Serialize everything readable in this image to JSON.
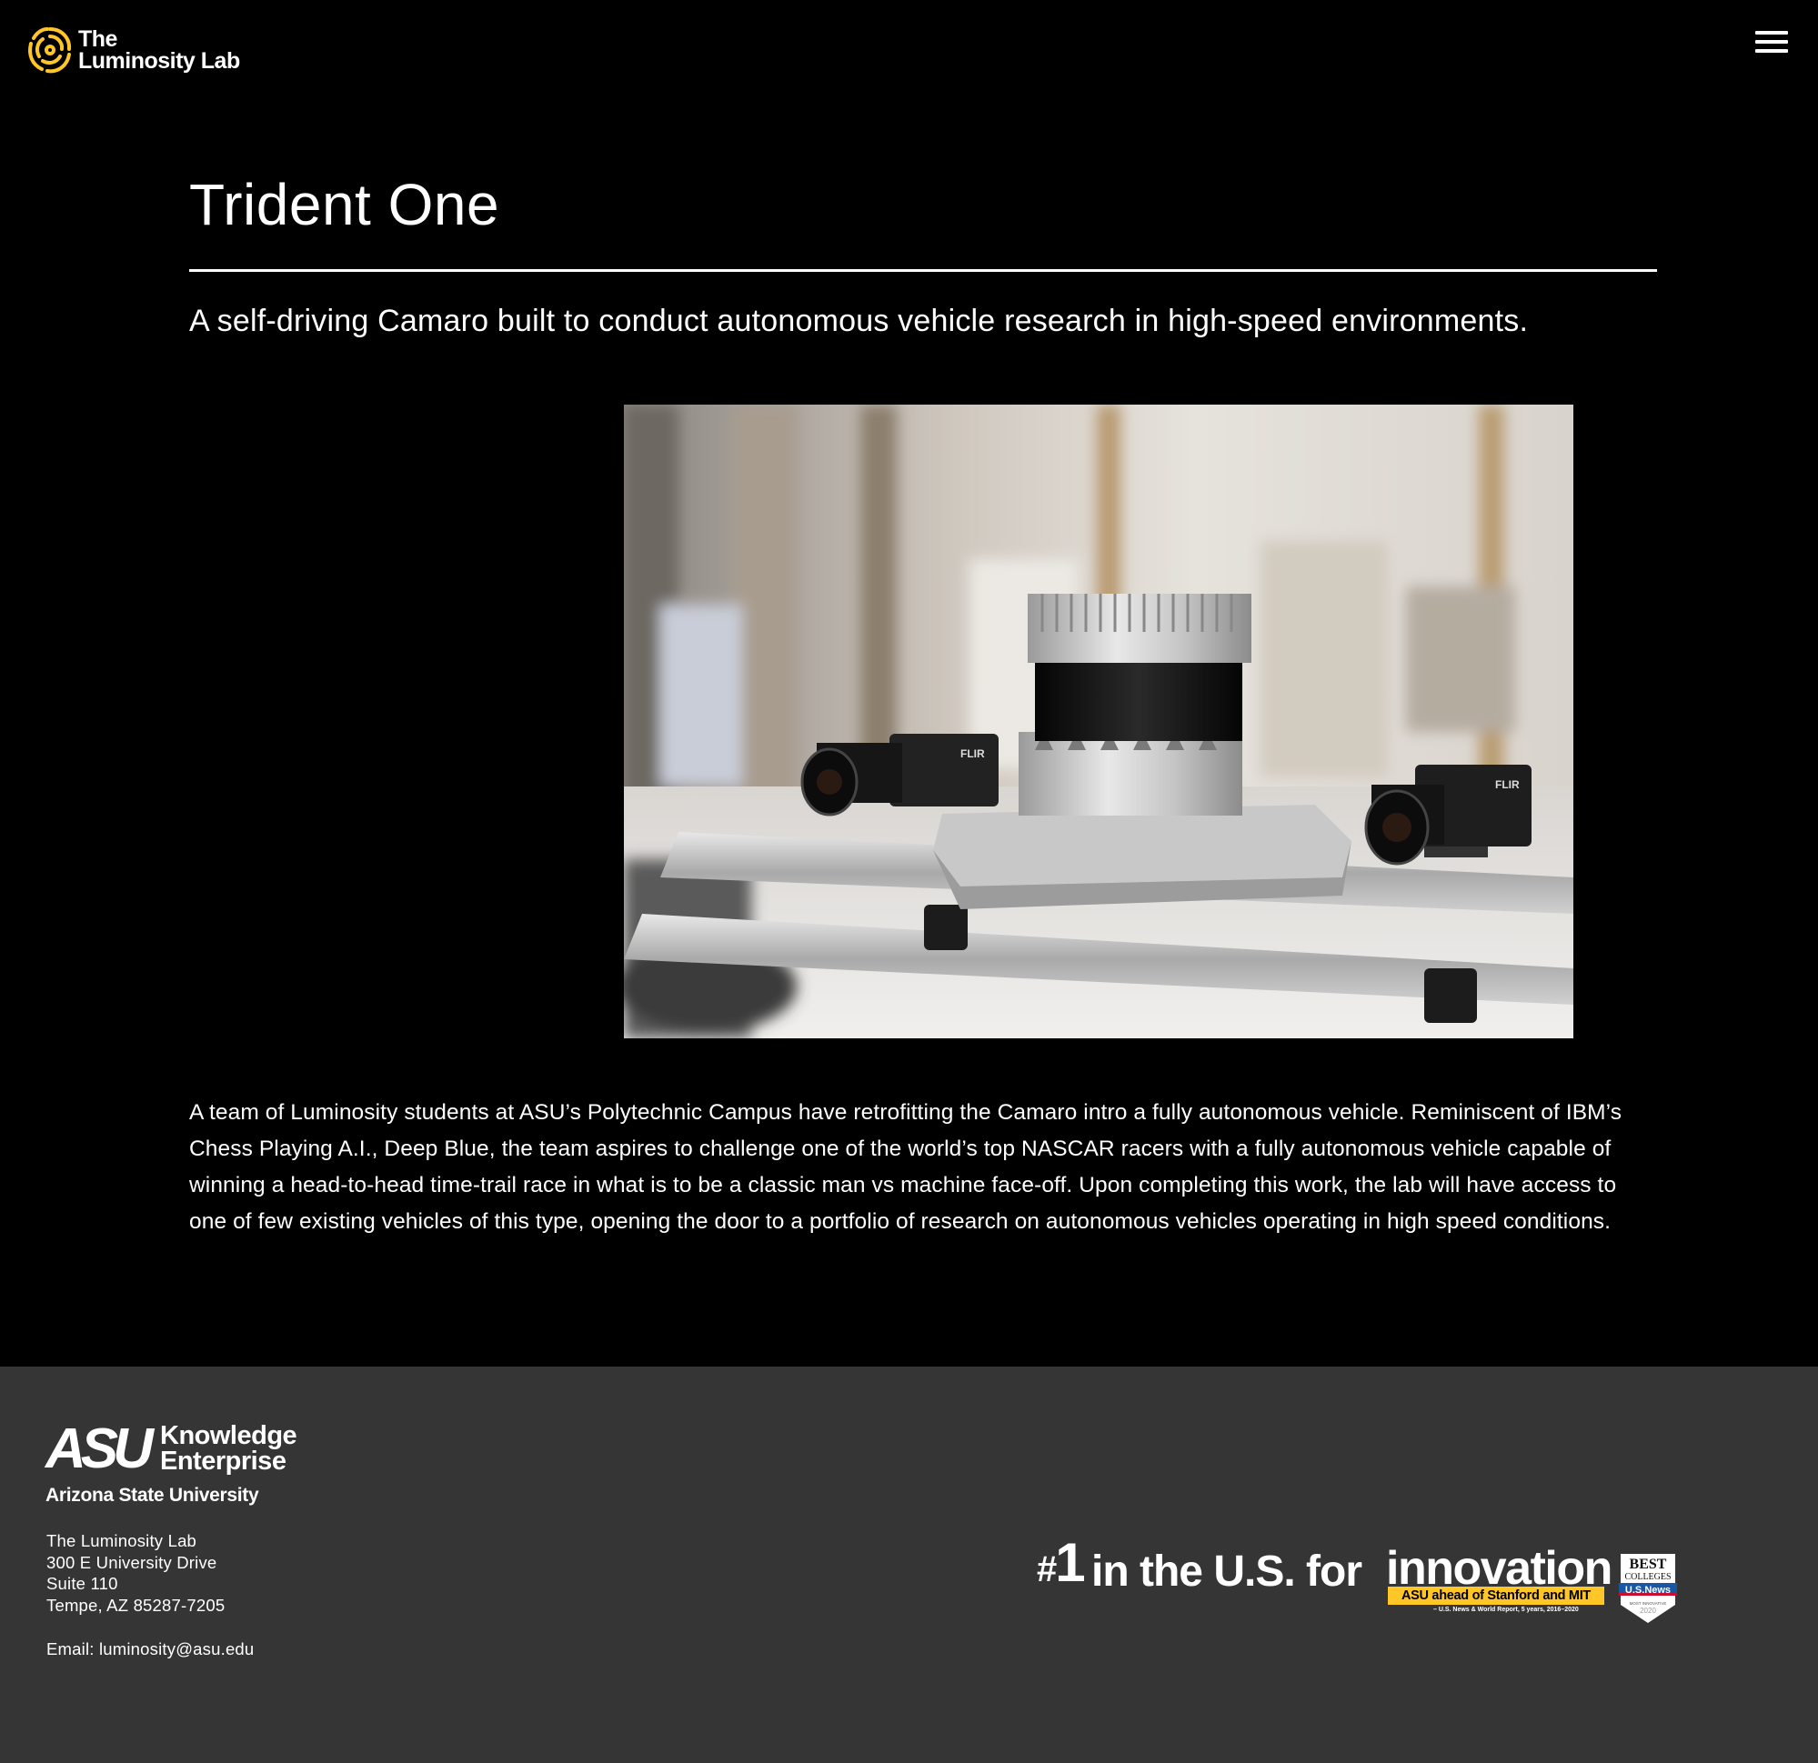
{
  "header": {
    "logo_line1": "The",
    "logo_line2": "Luminosity Lab",
    "menu_icon": "hamburger-menu-icon",
    "accent_color": "#ffc627"
  },
  "main": {
    "title": "Trident One",
    "subtitle": "A self-driving Camaro built to conduct autonomous vehicle research in high-speed environments.",
    "hero_image": "lidar-and-camera-rig-photo",
    "hero_camera_brand": "FLIR",
    "body": "A team of Luminosity students at ASU’s Polytechnic Campus have retrofitting the Camaro intro a fully autonomous vehicle. Reminiscent of IBM’s Chess Playing A.I., Deep Blue, the team aspires to challenge one of the world’s top NASCAR racers with a fully autonomous vehicle capable of winning a head-to-head time-trail race in what is to be a classic man vs machine face-off. Upon completing this work, the lab will have access to one of few existing vehicles of this type, opening the door to a portfolio of research on autonomous vehicles operating in high speed conditions."
  },
  "footer": {
    "background": "#353535",
    "asu_mark": "ASU",
    "asu_knowledge": "Knowledge",
    "asu_enterprise": "Enterprise",
    "asu_university": "Arizona State University",
    "address": [
      "The Luminosity Lab",
      "300 E University Drive",
      "Suite 110",
      "Tempe, AZ 85287-7205"
    ],
    "email_label": "Email: ",
    "email": "luminosity@asu.edu",
    "innovation": {
      "hash": "#",
      "number": "1",
      "text": "in the U.S. for",
      "word": "innovation",
      "bar_text": "ASU ahead of Stanford and MIT",
      "source": "– U.S. News & World Report, 5 years, 2016–2020",
      "badge_best": "BEST",
      "badge_colleges": "COLLEGES",
      "badge_brand": "U.S.News",
      "badge_sub": "MOST INNOVATIVE",
      "badge_year": "2020"
    }
  }
}
